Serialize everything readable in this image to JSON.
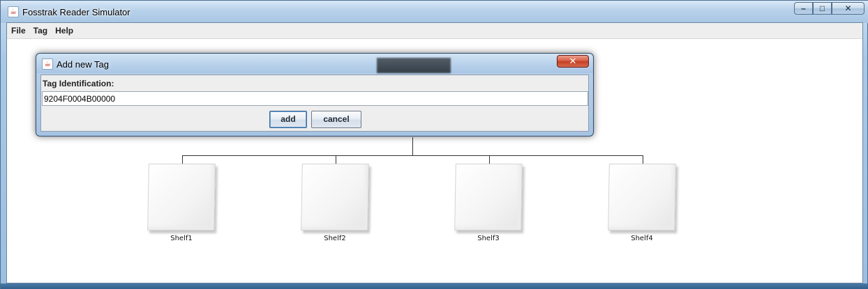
{
  "window": {
    "title": "Fosstrak Reader Simulator",
    "app_icon": "java-cup-icon",
    "controls": {
      "minimize": "–",
      "maximize": "□",
      "close": "✕"
    }
  },
  "menu": {
    "items": [
      {
        "label": "File"
      },
      {
        "label": "Tag"
      },
      {
        "label": "Help"
      }
    ]
  },
  "shelves": [
    {
      "label": "Shelf1"
    },
    {
      "label": "Shelf2"
    },
    {
      "label": "Shelf3"
    },
    {
      "label": "Shelf4"
    }
  ],
  "dialog": {
    "title": "Add new Tag",
    "icon": "java-cup-icon",
    "close_glyph": "✕",
    "field_label": "Tag Identification:",
    "tag_value": "9204F0004B00000",
    "add_label": "add",
    "cancel_label": "cancel"
  },
  "colors": {
    "title_bar": "#b7d1ea",
    "dialog_close": "#c23f22",
    "canvas": "#ffffff"
  }
}
